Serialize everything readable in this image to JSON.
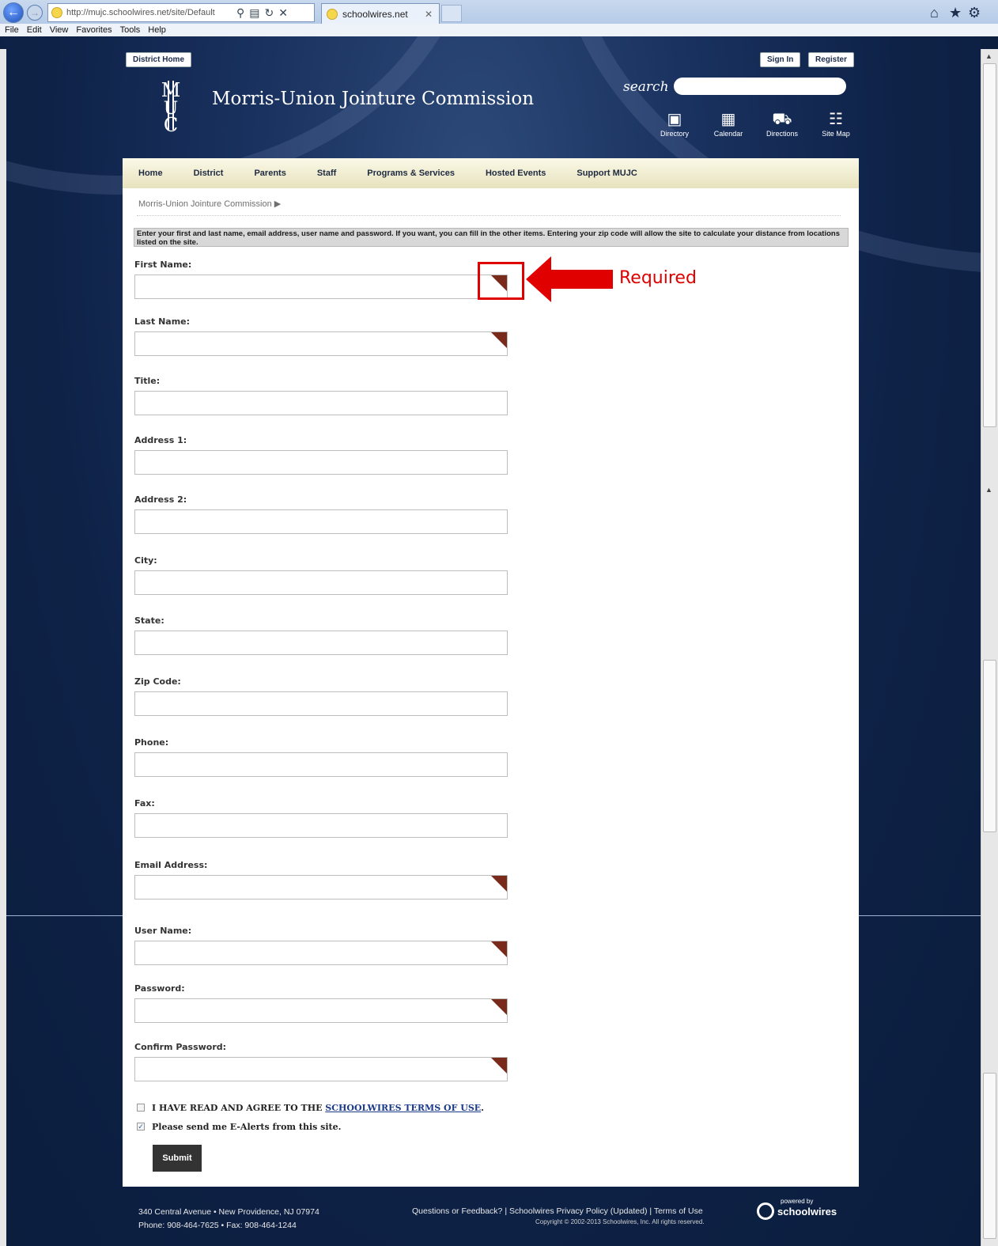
{
  "browser": {
    "url": "http://mujc.schoolwires.net/site/Default",
    "tab_title": "schoolwires.net",
    "menu": [
      "File",
      "Edit",
      "View",
      "Favorites",
      "Tools",
      "Help"
    ]
  },
  "header": {
    "district_home": "District Home",
    "sign_in": "Sign In",
    "register": "Register",
    "site_title": "Morris-Union Jointure Commission",
    "search_label": "search",
    "quick_links": [
      "Directory",
      "Calendar",
      "Directions",
      "Site Map"
    ]
  },
  "nav": [
    "Home",
    "District",
    "Parents",
    "Staff",
    "Programs & Services",
    "Hosted Events",
    "Support MUJC"
  ],
  "breadcrumb": "Morris-Union Jointure Commission",
  "intro": "Enter your first and last name, email address, user name and password. If you want, you can fill in the other items. Entering your zip code will allow the site to calculate your distance from locations listed on the site.",
  "fields": [
    {
      "label": "First Name:",
      "required": true
    },
    {
      "label": "Last Name:",
      "required": true
    },
    {
      "label": "Title:",
      "required": false
    },
    {
      "label": "Address 1:",
      "required": false
    },
    {
      "label": "Address 2:",
      "required": false
    },
    {
      "label": "City:",
      "required": false
    },
    {
      "label": "State:",
      "required": false
    },
    {
      "label": "Zip Code:",
      "required": false
    },
    {
      "label": "Phone:",
      "required": false
    },
    {
      "label": "Fax:",
      "required": false
    },
    {
      "label": "Email Address:",
      "required": true
    },
    {
      "label": "User Name:",
      "required": true
    },
    {
      "label": "Password:",
      "required": true
    },
    {
      "label": "Confirm Password:",
      "required": true
    }
  ],
  "terms": {
    "prefix": "I HAVE READ AND AGREE TO THE ",
    "link": "SCHOOLWIRES TERMS OF USE",
    "suffix": ".",
    "checked": false
  },
  "ealerts": {
    "label": "Please send me E-Alerts from this site.",
    "checked": true
  },
  "submit": "Submit",
  "annotation": "Required",
  "footer": {
    "address": "340 Central Avenue • New Providence, NJ 07974",
    "phone": "Phone: 908-464-7625 • Fax: 908-464-1244",
    "links": "Questions or Feedback?   |   Schoolwires Privacy Policy (Updated)   |   Terms of Use",
    "copyright": "Copyright © 2002-2013 Schoolwires, Inc. All rights reserved.",
    "powered_by": "powered by",
    "brand": "schoolwires"
  },
  "colors": {
    "required_marker": "#7a2a1a",
    "annotation": "#e00000",
    "nav_bg": "#efeacb"
  }
}
